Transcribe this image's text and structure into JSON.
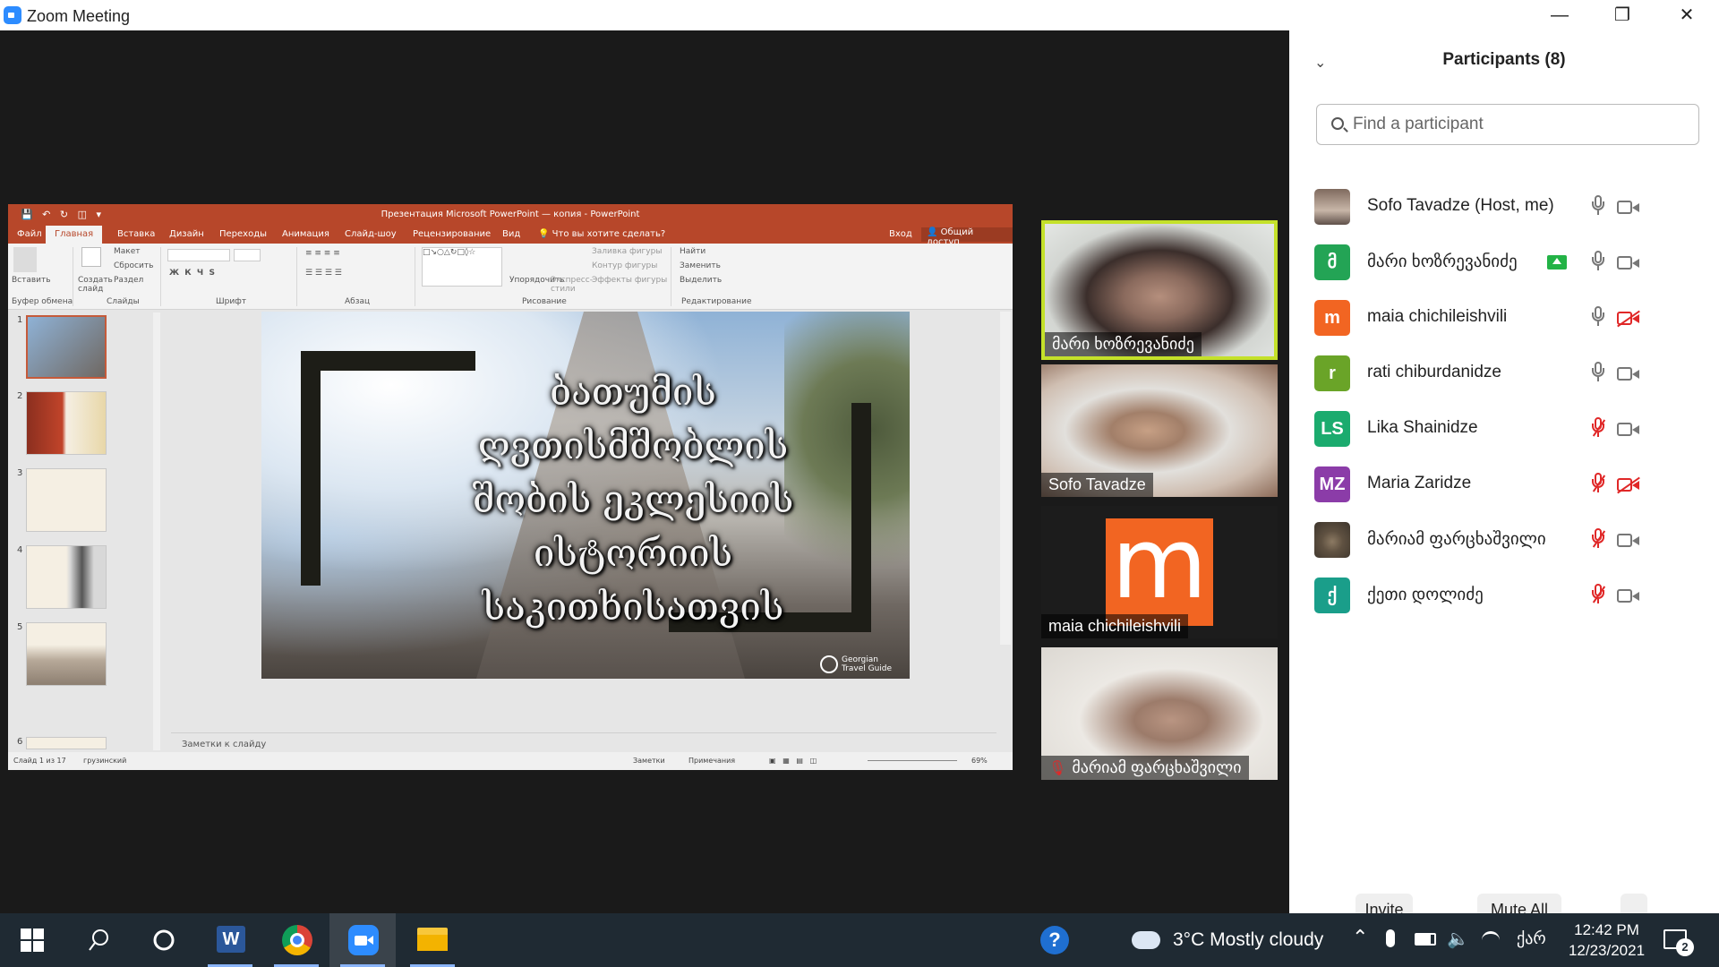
{
  "window": {
    "title": "Zoom Meeting"
  },
  "powerpoint": {
    "doc_title": "Презентация Microsoft PowerPoint — копия - PowerPoint",
    "tabs": [
      "Файл",
      "Главная",
      "Вставка",
      "Дизайн",
      "Переходы",
      "Анимация",
      "Слайд-шоу",
      "Рецензирование",
      "Вид"
    ],
    "tell_me": "Что вы хотите сделать?",
    "signin": "Вход",
    "share": "Общий доступ",
    "ribbon": {
      "paste": "Вставить",
      "create_slide": "Создать слайд",
      "layout": "Макет",
      "reset": "Сбросить",
      "section": "Раздел",
      "arrange": "Упорядочить",
      "quick_styles": "Экспресс-стили",
      "shape_fill": "Заливка фигуры",
      "shape_outline": "Контур фигуры",
      "shape_effects": "Эффекты фигуры",
      "find": "Найти",
      "replace": "Заменить",
      "select": "Выделить",
      "groups": [
        "Буфер обмена",
        "Слайды",
        "Шрифт",
        "Абзац",
        "Рисование",
        "Редактирование"
      ]
    },
    "slide_numbers": [
      "1",
      "2",
      "3",
      "4",
      "5",
      "6"
    ],
    "slide_title": "ბათუმის ღვთისმშობლის შობის ეკლესიის ისტორიის საკითხისათვის",
    "slide_logo": "Georgian Travel Guide",
    "notes_placeholder": "Заметки к слайду",
    "status": {
      "slide_count": "Слайд 1 из 17",
      "language": "грузинский",
      "notes": "Заметки",
      "comments": "Примечания",
      "zoom": "69%"
    }
  },
  "videos": [
    {
      "name": "მარი ხოზრევანიძე",
      "speaking": true
    },
    {
      "name": "Sofo Tavadze"
    },
    {
      "name": "maia chichileishvili",
      "logo_letter": "m"
    },
    {
      "name": "მარიამ ფარცხაშვილი",
      "muted": true
    }
  ],
  "participants": {
    "title": "Participants (8)",
    "search_placeholder": "Find a participant",
    "list": [
      {
        "name": "Sofo Tavadze (Host, me)",
        "avatar": "photo",
        "mic_muted": false,
        "cam_off": false
      },
      {
        "name": "მარი ხოზრევანიძე",
        "initials": "მ",
        "color": "#23a455",
        "sharing": true,
        "mic_muted": false,
        "cam_off": false
      },
      {
        "name": "maia chichileishvili",
        "initials": "m",
        "color": "#f26522",
        "mic_muted": false,
        "cam_off": true
      },
      {
        "name": "rati chiburdanidze",
        "initials": "r",
        "color": "#6aa428",
        "mic_muted": false,
        "cam_off": false
      },
      {
        "name": "Lika Shainidze",
        "initials": "LS",
        "color": "#1bab6e",
        "mic_muted": true,
        "cam_off": false
      },
      {
        "name": "Maria Zaridze",
        "initials": "MZ",
        "color": "#8b3ca8",
        "mic_muted": true,
        "cam_off": true
      },
      {
        "name": "მარიამ ფარცხაშვილი",
        "avatar": "cat",
        "mic_muted": true,
        "cam_off": false
      },
      {
        "name": "ქეთი დოლიძე",
        "initials": "ქ",
        "color": "#1a9e8a",
        "mic_muted": true,
        "cam_off": false
      }
    ],
    "invite": "Invite",
    "mute_all": "Mute All",
    "more": "..."
  },
  "taskbar": {
    "apps": [
      "start-icon",
      "search-icon",
      "cortana-icon",
      "word-icon",
      "chrome-icon",
      "zoom-icon",
      "file-explorer-icon"
    ],
    "weather": "3°C  Mostly cloudy",
    "language": "ქარ",
    "time": "12:42 PM",
    "date": "12/23/2021",
    "notification_count": "2"
  }
}
